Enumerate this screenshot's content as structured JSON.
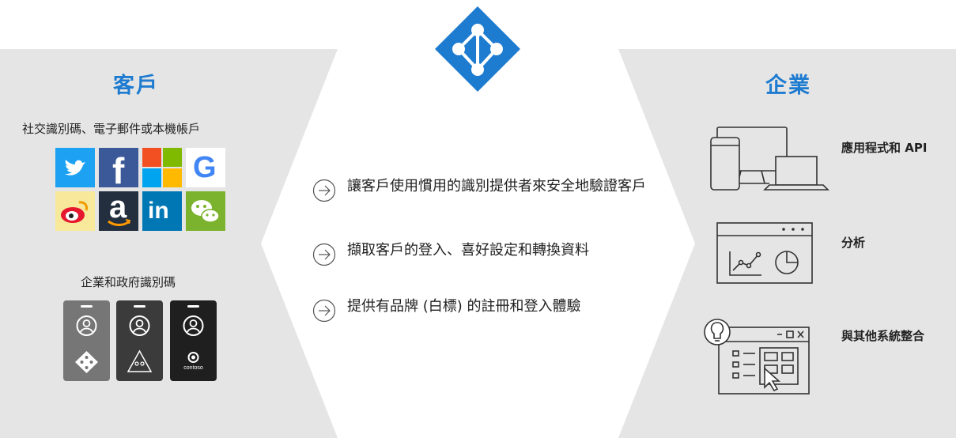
{
  "logo": {
    "icon": "azure-ad-b2c-icon",
    "color": "#1d7bd0"
  },
  "customer": {
    "title": "客戶",
    "social_caption": "社交識別碼、電子郵件或本機帳戶",
    "social_icons": [
      "twitter-icon",
      "facebook-icon",
      "microsoft-icon",
      "google-icon",
      "weibo-icon",
      "amazon-icon",
      "linkedin-icon",
      "wechat-icon"
    ],
    "gov_caption": "企業和政府識別碼",
    "gov_badges": [
      "azure-ad-badge",
      "government-badge",
      "contoso-badge"
    ],
    "contoso_label": "contoso"
  },
  "features": [
    {
      "text": "讓客戶使用慣用的識別提供者來安全地驗證客戶"
    },
    {
      "text": "擷取客戶的登入、喜好設定和轉換資料"
    },
    {
      "text": "提供有品牌 (白標) 的註冊和登入體驗"
    }
  ],
  "enterprise": {
    "title": "企業",
    "items": [
      {
        "label": "應用程式和 API",
        "icon": "devices-icon"
      },
      {
        "label": "分析",
        "icon": "analytics-icon"
      },
      {
        "label": "與其他系統整合",
        "icon": "integration-icon"
      }
    ]
  },
  "colors": {
    "accent": "#1d7bd0",
    "panel": "#e5e5e5"
  }
}
